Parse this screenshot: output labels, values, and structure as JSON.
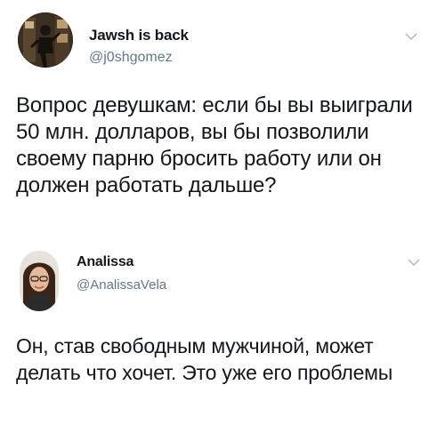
{
  "tweets": [
    {
      "display_name": "Jawsh is back",
      "handle": "@j0shgomez",
      "avatar_icon": "user-avatar-dark-photo",
      "menu_icon": "chevron-down-icon",
      "text": "Вопрос девушкам: если бы вы выиграли 50 млн. долларов, вы бы позволили своему парню бросить работу или он должен работать дальше?"
    },
    {
      "display_name": "Analissa",
      "handle": "@AnalissaVela",
      "avatar_icon": "user-avatar-woman-photo",
      "menu_icon": "chevron-down-icon",
      "text": "Он, став свободным мужчиной, может делать что хочет. Это уже его проблемы"
    }
  ],
  "colors": {
    "text": "#14171a",
    "secondary": "#657786",
    "background": "#ffffff"
  }
}
